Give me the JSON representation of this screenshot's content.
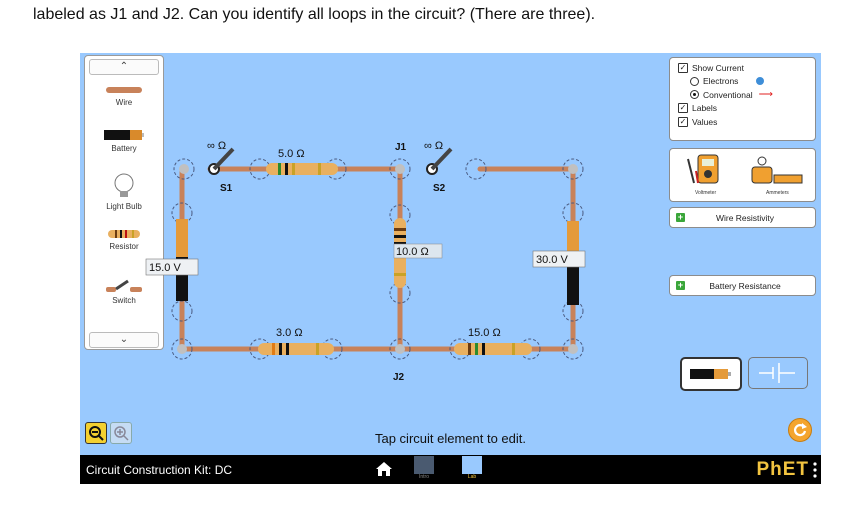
{
  "question_text": "labeled as J1 and J2. Can you identify all loops in the circuit? (There are three).",
  "toolbox": {
    "items": [
      {
        "label": "Wire"
      },
      {
        "label": "Battery"
      },
      {
        "label": "Light Bulb"
      },
      {
        "label": "Resistor"
      },
      {
        "label": "Switch"
      }
    ]
  },
  "options_panel": {
    "show_current": "Show Current",
    "electrons": "Electrons",
    "conventional": "Conventional",
    "labels": "Labels",
    "values": "Values",
    "show_current_checked": true,
    "conventional_selected": true,
    "labels_checked": true,
    "values_checked": true
  },
  "sensors": {
    "voltmeter": "Voltmeter",
    "ammeters": "Ammeters"
  },
  "wire_resistivity": "Wire Resistivity",
  "battery_resistance": "Battery Resistance",
  "circuit": {
    "switch1_resistance": "∞ Ω",
    "switch1_label": "S1",
    "switch2_resistance": "∞ Ω",
    "switch2_label": "S2",
    "junction1": "J1",
    "junction2": "J2",
    "r_top": "5.0 Ω",
    "r_middle": "10.0 Ω",
    "r_bottom_left": "3.0 Ω",
    "r_bottom_right": "15.0 Ω",
    "battery_left": "15.0 V",
    "battery_right": "30.0 V"
  },
  "status_text": "Tap circuit element to edit.",
  "bottom_bar": {
    "sim_title": "Circuit Construction Kit: DC",
    "tab_intro": "Intro",
    "tab_lab": "Lab",
    "brand": "PhET"
  },
  "colors": {
    "sim_background": "#99c9fe",
    "wire": "#c8825a",
    "reset_button": "#f4a52e",
    "brand_gold": "#f2c440"
  }
}
